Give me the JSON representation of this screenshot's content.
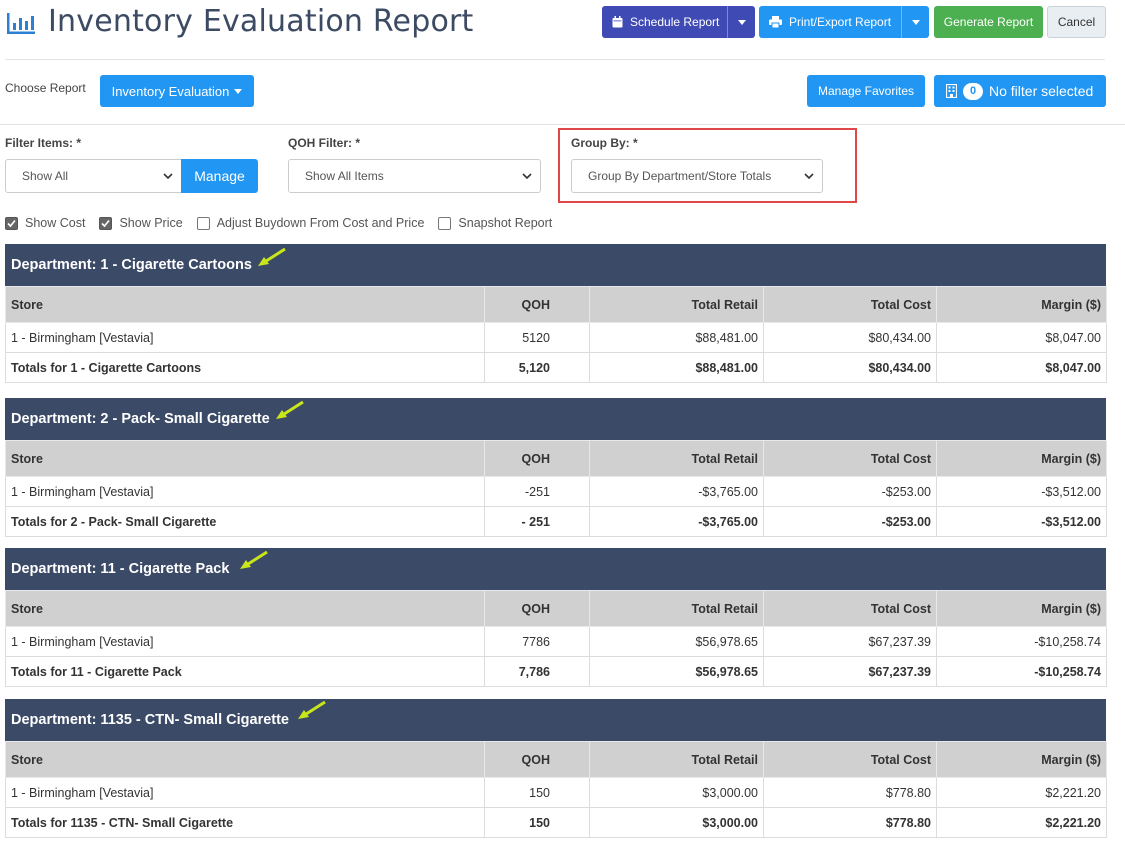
{
  "header": {
    "title": "Inventory Evaluation Report",
    "schedule_label": "Schedule Report",
    "print_label": "Print/Export Report",
    "generate_label": "Generate Report",
    "cancel_label": "Cancel"
  },
  "choose": {
    "label": "Choose Report",
    "report_button": "Inventory Evaluation",
    "favorites_button": "Manage Favorites",
    "filter_count": "0",
    "filter_label": "No filter selected"
  },
  "filters": {
    "filter_items_label": "Filter Items: *",
    "filter_items_value": "Show All",
    "manage_label": "Manage",
    "qoh_label": "QOH Filter: *",
    "qoh_value": "Show All Items",
    "group_by_label": "Group By: *",
    "group_by_value": "Group By Department/Store Totals"
  },
  "checkboxes": [
    {
      "label": "Show Cost",
      "checked": true
    },
    {
      "label": "Show Price",
      "checked": true
    },
    {
      "label": "Adjust Buydown From Cost and Price",
      "checked": false
    },
    {
      "label": "Snapshot Report",
      "checked": false
    }
  ],
  "columns": [
    "Store",
    "QOH",
    "Total Retail",
    "Total Cost",
    "Margin ($)"
  ],
  "departments": [
    {
      "title": "Department: 1 - Cigarette Cartoons",
      "row": [
        "1 - Birmingham [Vestavia]",
        "5120",
        "$88,481.00",
        "$80,434.00",
        "$8,047.00"
      ],
      "totals": [
        "Totals for 1 - Cigarette Cartoons",
        "5,120",
        "$88,481.00",
        "$80,434.00",
        "$8,047.00"
      ]
    },
    {
      "title": "Department: 2 - Pack- Small Cigarette",
      "row": [
        "1 - Birmingham [Vestavia]",
        "-251",
        "-$3,765.00",
        "-$253.00",
        "-$3,512.00"
      ],
      "totals": [
        "Totals for 2 - Pack- Small Cigarette",
        "- 251",
        "-$3,765.00",
        "-$253.00",
        "-$3,512.00"
      ]
    },
    {
      "title": "Department: 11 - Cigarette Pack",
      "row": [
        "1 - Birmingham [Vestavia]",
        "7786",
        "$56,978.65",
        "$67,237.39",
        "-$10,258.74"
      ],
      "totals": [
        "Totals for 11 - Cigarette Pack",
        "7,786",
        "$56,978.65",
        "$67,237.39",
        "-$10,258.74"
      ]
    },
    {
      "title": "Department: 1135 - CTN- Small Cigarette",
      "row": [
        "1 - Birmingham [Vestavia]",
        "150",
        "$3,000.00",
        "$778.80",
        "$2,221.20"
      ],
      "totals": [
        "Totals for 1135 - CTN- Small Cigarette",
        "150",
        "$3,000.00",
        "$778.80",
        "$2,221.20"
      ]
    }
  ],
  "colors": {
    "header_bg": "#3b4a67",
    "primary": "#2196f3",
    "schedule": "#3f4ab5",
    "generate": "#4caf50",
    "highlight": "#e04848",
    "arrow": "#c8e619"
  }
}
